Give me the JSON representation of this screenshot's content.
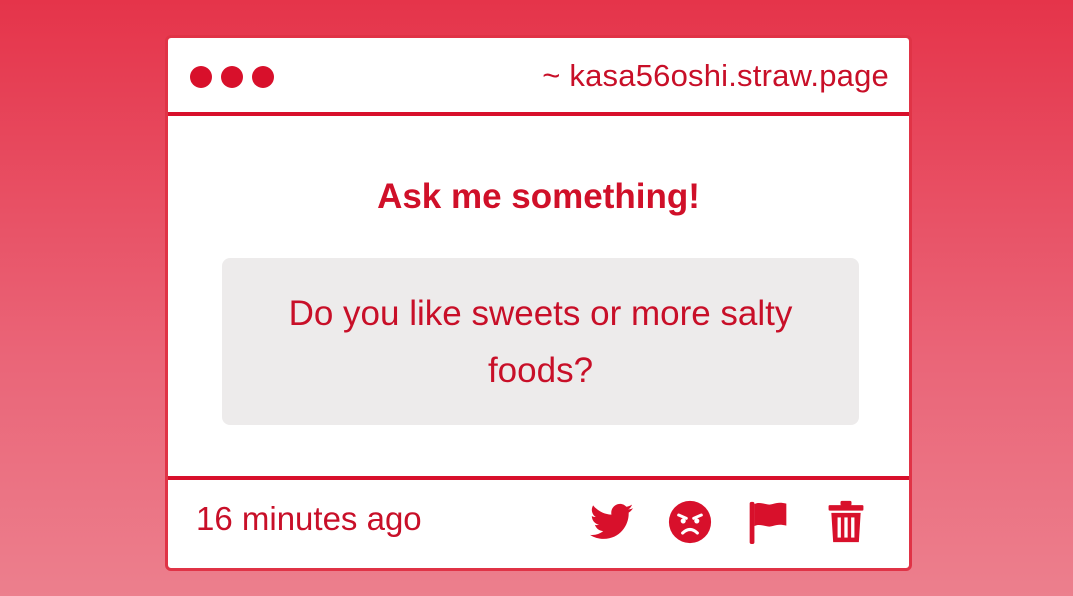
{
  "window": {
    "url": "~ kasa56oshi.straw.page"
  },
  "main": {
    "heading": "Ask me something!",
    "question": "Do you like sweets or more salty foods?"
  },
  "footer": {
    "timestamp": "16 minutes ago",
    "actions": [
      {
        "icon": "twitter-icon"
      },
      {
        "icon": "angry-face-icon"
      },
      {
        "icon": "flag-icon"
      },
      {
        "icon": "trash-icon"
      }
    ]
  },
  "colors": {
    "accent": "#d8102b",
    "background_top": "#e5344a",
    "background_bottom": "#ec7f8d",
    "question_bg": "#edebeb"
  }
}
